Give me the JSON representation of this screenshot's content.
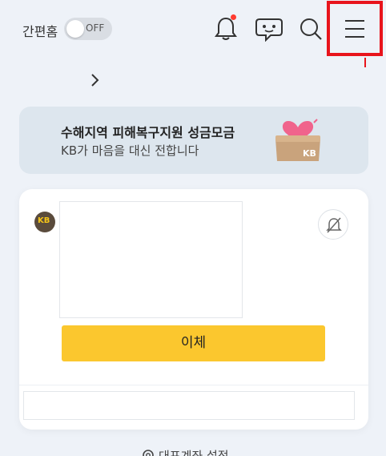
{
  "header": {
    "simple_home_label": "간편홈",
    "toggle_state": "OFF",
    "icons": [
      "bell-icon",
      "chatbot-icon",
      "search-icon",
      "menu-icon"
    ],
    "notification_dot_color": "#ff3b30",
    "highlight_color": "#e8141c"
  },
  "banner": {
    "title": "수해지역 피해복구지원 성금모금",
    "subtitle": "KB가 마음을 대신 전합니다"
  },
  "account_card": {
    "bank_logo_text": "KB",
    "transfer_button": "이체",
    "accent_color": "#fbc72e"
  },
  "footer": {
    "rep_account_label": "대표계좌 설정"
  }
}
